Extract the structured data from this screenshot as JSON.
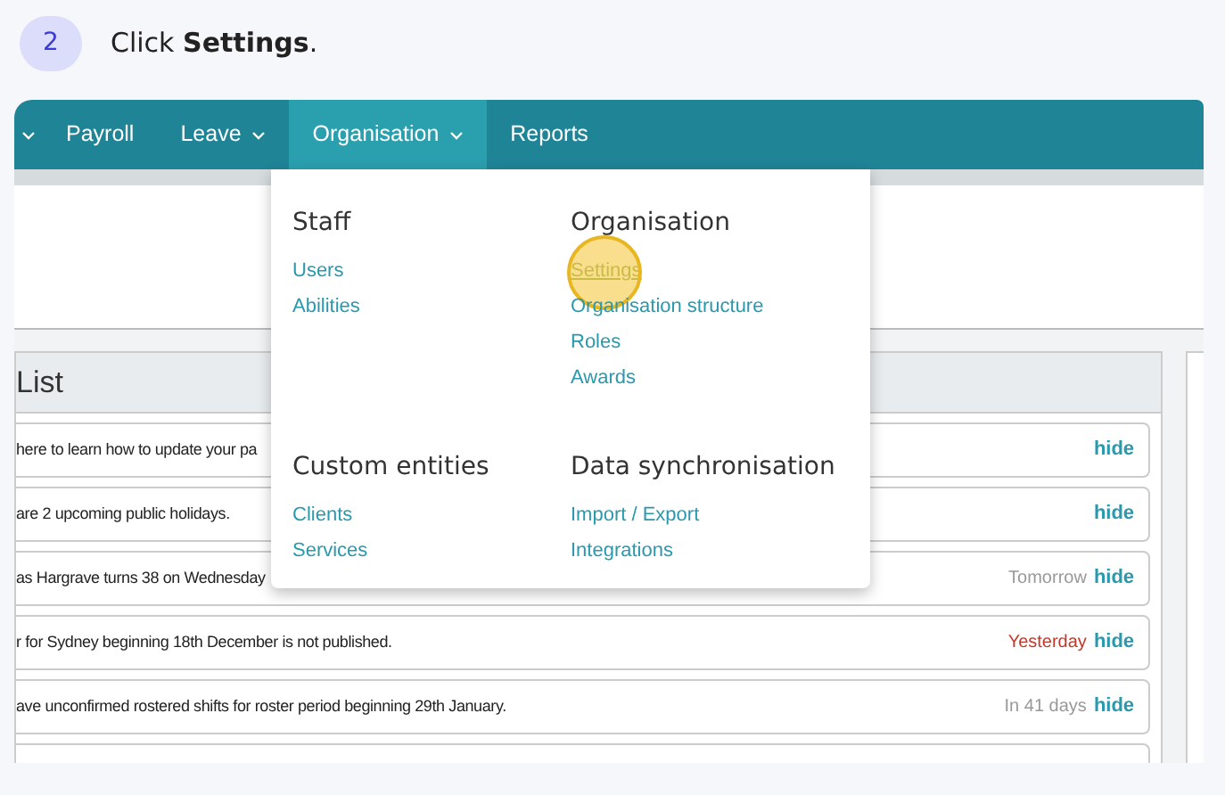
{
  "step": {
    "number": "2",
    "text": "Click **Settings**."
  },
  "nav": [
    {
      "kind": "item",
      "label": "Payroll",
      "selected": false
    },
    {
      "kind": "menu",
      "label": "Leave",
      "selected": false
    },
    {
      "kind": "menu",
      "label": "Organisation",
      "selected": true
    },
    {
      "kind": "item",
      "label": "Reports",
      "selected": false
    }
  ],
  "panel": {
    "title": "List"
  },
  "rows": [
    {
      "text": "here to learn how to update your pa",
      "due": "",
      "hide": "hide"
    },
    {
      "text": "are 2 upcoming public holidays.",
      "due": "",
      "hide": "hide"
    },
    {
      "text": "as Hargrave turns 38 on Wednesday",
      "due": "Tomorrow",
      "color": "#999999",
      "hide": "hide"
    },
    {
      "text": "r for Sydney beginning 18th December is not published.",
      "due": "Yesterday",
      "color": "#c0392b",
      "hide": "hide"
    },
    {
      "text": "ave unconfirmed rostered shifts for roster period beginning 29th January.",
      "due": "In 41 days",
      "color": "#999999",
      "hide": "hide"
    }
  ],
  "dropdown": {
    "sections": [
      {
        "title": "Staff",
        "links": [
          {
            "label": "Users",
            "highlighted": false
          },
          {
            "label": "Abilities",
            "highlighted": false
          }
        ]
      },
      {
        "title": "Organisation",
        "links": [
          {
            "label": "Settings",
            "highlighted": true
          },
          {
            "label": "Organisation structure",
            "highlighted": false
          },
          {
            "label": "Roles",
            "highlighted": false
          },
          {
            "label": "Awards",
            "highlighted": false
          }
        ]
      },
      {
        "title": "Custom entities",
        "links": [
          {
            "label": "Clients",
            "highlighted": false
          },
          {
            "label": "Services",
            "highlighted": false
          }
        ]
      },
      {
        "title": "Data synchronisation",
        "links": [
          {
            "label": "Import / Export",
            "highlighted": false
          },
          {
            "label": "Integrations",
            "highlighted": false
          }
        ]
      }
    ]
  }
}
